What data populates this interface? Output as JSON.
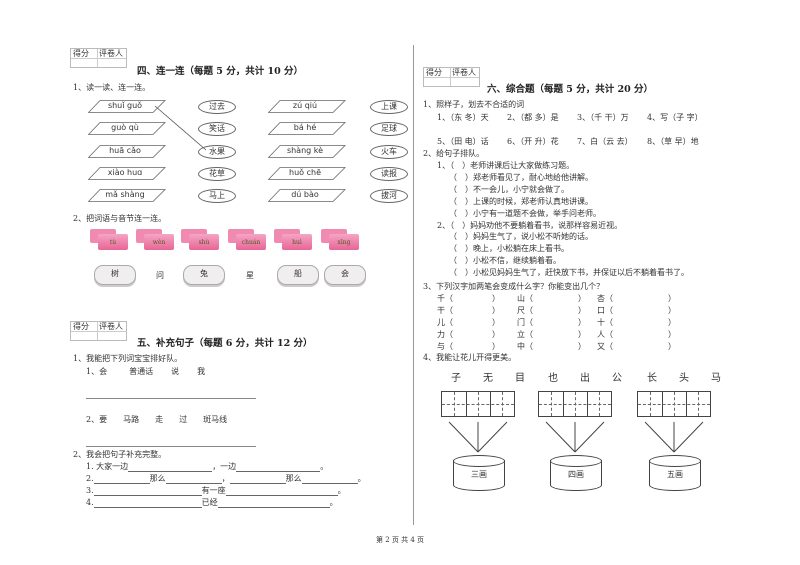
{
  "score_box": {
    "score": "得分",
    "grader": "评卷人"
  },
  "s4": {
    "title": "四、连一连（每题 5 分，共计 10 分）",
    "q1": "1、读一读、连一连。",
    "left_pinyin": [
      "shuǐ guǒ",
      "guò qù",
      "huā cǎo",
      "xiào huɑ",
      "mǎ shàng"
    ],
    "left_words": [
      "过去",
      "笑话",
      "水果",
      "花草",
      "马上"
    ],
    "right_pinyin": [
      "zú qiú",
      "bá hé",
      "shàng kè",
      "huǒ chē",
      "dú bào"
    ],
    "right_words": [
      "上课",
      "足球",
      "火车",
      "读报",
      "拔河"
    ],
    "q2": "2、把词语与音节连一连。",
    "syllables": [
      "tù",
      "wèn",
      "shù",
      "chuán",
      "huì",
      "xīng"
    ],
    "chars": [
      "树",
      "问",
      "兔",
      "星",
      "船",
      "会"
    ]
  },
  "s5": {
    "title": "五、补充句子（每题 6 分，共计 12 分）",
    "q1": "1、我能把下列词宝宝排好队。",
    "q1a": [
      "1、会",
      "普通话",
      "说",
      "我"
    ],
    "q1b": [
      "2、要",
      "马路",
      "走",
      "过",
      "斑马线"
    ],
    "q2": "2、我会把句子补充完整。",
    "r1": [
      "1. 大家一边",
      "，一边",
      "。"
    ],
    "r2": [
      "2.",
      "那么",
      "，",
      "那么",
      "。"
    ],
    "r3": [
      "3.",
      "有一座",
      "。"
    ],
    "r4": [
      "4.",
      "已经",
      "。"
    ]
  },
  "s6": {
    "title": "六、综合题（每题 5 分，共计 20 分）",
    "q1": "1、照样子，划去不合适的词",
    "q1_row1": [
      "1、（东 冬）天",
      "2、（都 多）是",
      "3、（千 干）万",
      "4、写（子 字）"
    ],
    "q1_row2": [
      "5、（田 电）话",
      "6、（开 升）花",
      "7、白（云 去）",
      "8、（草 早）地"
    ],
    "q2": "2、给句子排队。",
    "q2_lines": [
      "1、（　）老师讲课后让大家做练习题。",
      "（　）郑老师看见了，耐心地给他讲解。",
      "（　）不一会儿，小宁就会做了。",
      "（　）上课的时候，郑老师认真地讲课。",
      "（　）小宁有一道题不会做，举手问老师。",
      "2、（　）妈妈劝他不要躺着看书，说那样容易近视。",
      "（　）妈妈生气了，说小松不听她的话。",
      "（　）晚上，小松躺在床上看书。",
      "（　）小松不信，继续躺着看。",
      "（　）小松见妈妈生气了，赶快放下书，并保证以后不躺着看书了。"
    ],
    "q3": "3、下列汉字加两笔会变成什么字？你能变出几个？",
    "q3_grid": [
      [
        "千（",
        "）",
        "山（",
        "）",
        "杏（",
        "）"
      ],
      [
        "干（",
        "）",
        "尺（",
        "）",
        "口（",
        "）"
      ],
      [
        "儿（",
        "）",
        "门（",
        "）",
        "十（",
        "）"
      ],
      [
        "力（",
        "）",
        "立（",
        "）",
        "人（",
        "）"
      ],
      [
        "与（",
        "）",
        "中（",
        "）",
        "又（",
        "）"
      ]
    ],
    "q4": "4、我能让花儿开得更美。",
    "q4_chars": [
      "子",
      "无",
      "目",
      "也",
      "出",
      "公",
      "长",
      "头",
      "马"
    ],
    "q4_pots": [
      "三画",
      "四画",
      "五画"
    ]
  },
  "footer": "第 2 页 共 4 页"
}
